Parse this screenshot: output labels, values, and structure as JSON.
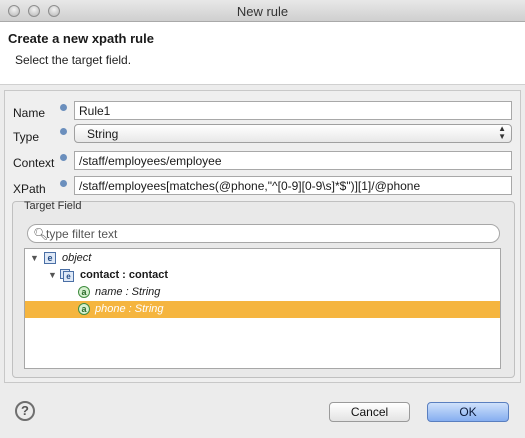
{
  "window": {
    "title": "New rule"
  },
  "header": {
    "title": "Create a new xpath rule",
    "subtitle": "Select the target field."
  },
  "form": {
    "name": {
      "label": "Name",
      "value": "Rule1"
    },
    "type": {
      "label": "Type",
      "value": "String"
    },
    "context": {
      "label": "Context",
      "value": "/staff/employees/employee"
    },
    "xpath": {
      "label": "XPath",
      "value": "/staff/employees[matches(@phone,\"^[0-9][0-9\\s]*$\")][1]/@phone"
    }
  },
  "target_field": {
    "group_label": "Target Field",
    "filter_placeholder": "type filter text",
    "tree": [
      {
        "label": "object",
        "icon": "element-icon",
        "level": 0,
        "expanded": true
      },
      {
        "label": "contact : contact",
        "icon": "complex-element-icon",
        "level": 1,
        "expanded": true
      },
      {
        "label": "name : String",
        "icon": "attribute-icon",
        "level": 2
      },
      {
        "label": "phone : String",
        "icon": "attribute-icon",
        "level": 2,
        "selected": true
      }
    ]
  },
  "buttons": {
    "help_label": "?",
    "cancel_label": "Cancel",
    "ok_label": "OK"
  },
  "colors": {
    "selection": "#f5b53f",
    "ok_button": "#86aef0",
    "info_icon": "#6b8fbd"
  }
}
